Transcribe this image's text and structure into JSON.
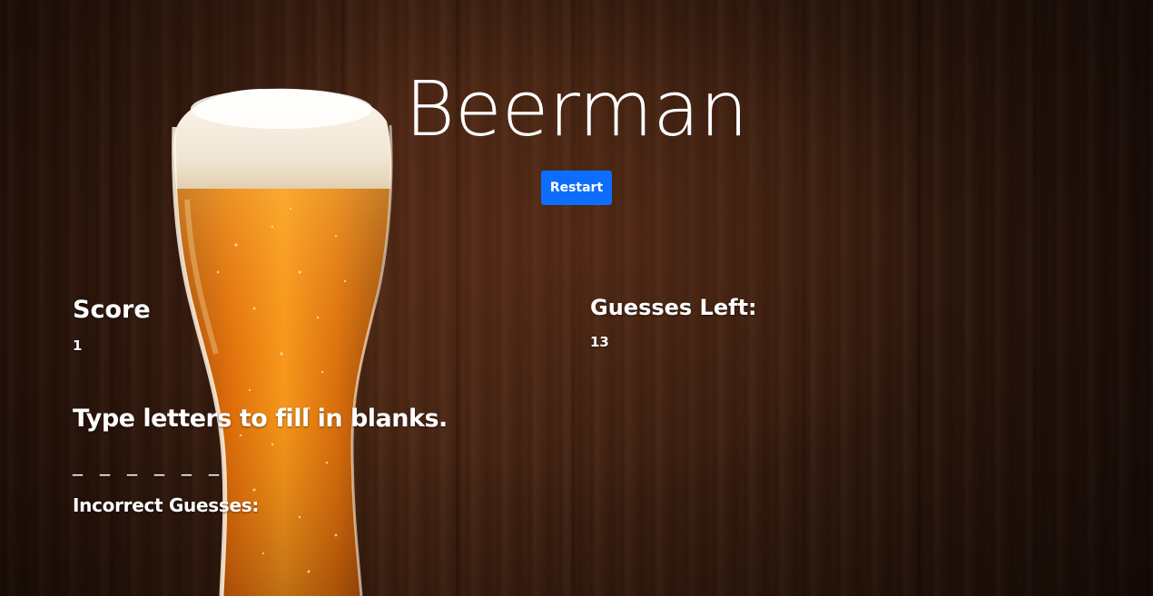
{
  "game": {
    "title": "Beerman",
    "restart_label": "Restart"
  },
  "score": {
    "heading": "Score",
    "value": "1"
  },
  "guesses_left": {
    "heading": "Guesses Left:",
    "value": "13"
  },
  "instructions": "Type letters to fill in blanks.",
  "word_blanks": "_ _ _ _ _ _",
  "incorrect_guesses": {
    "heading": "Incorrect Guesses:",
    "letters": ""
  },
  "colors": {
    "accent": "#0d6efd",
    "text": "#ffffff",
    "background": "#3a1d10",
    "beer": "#e8850c",
    "foam": "#f6efe4"
  }
}
